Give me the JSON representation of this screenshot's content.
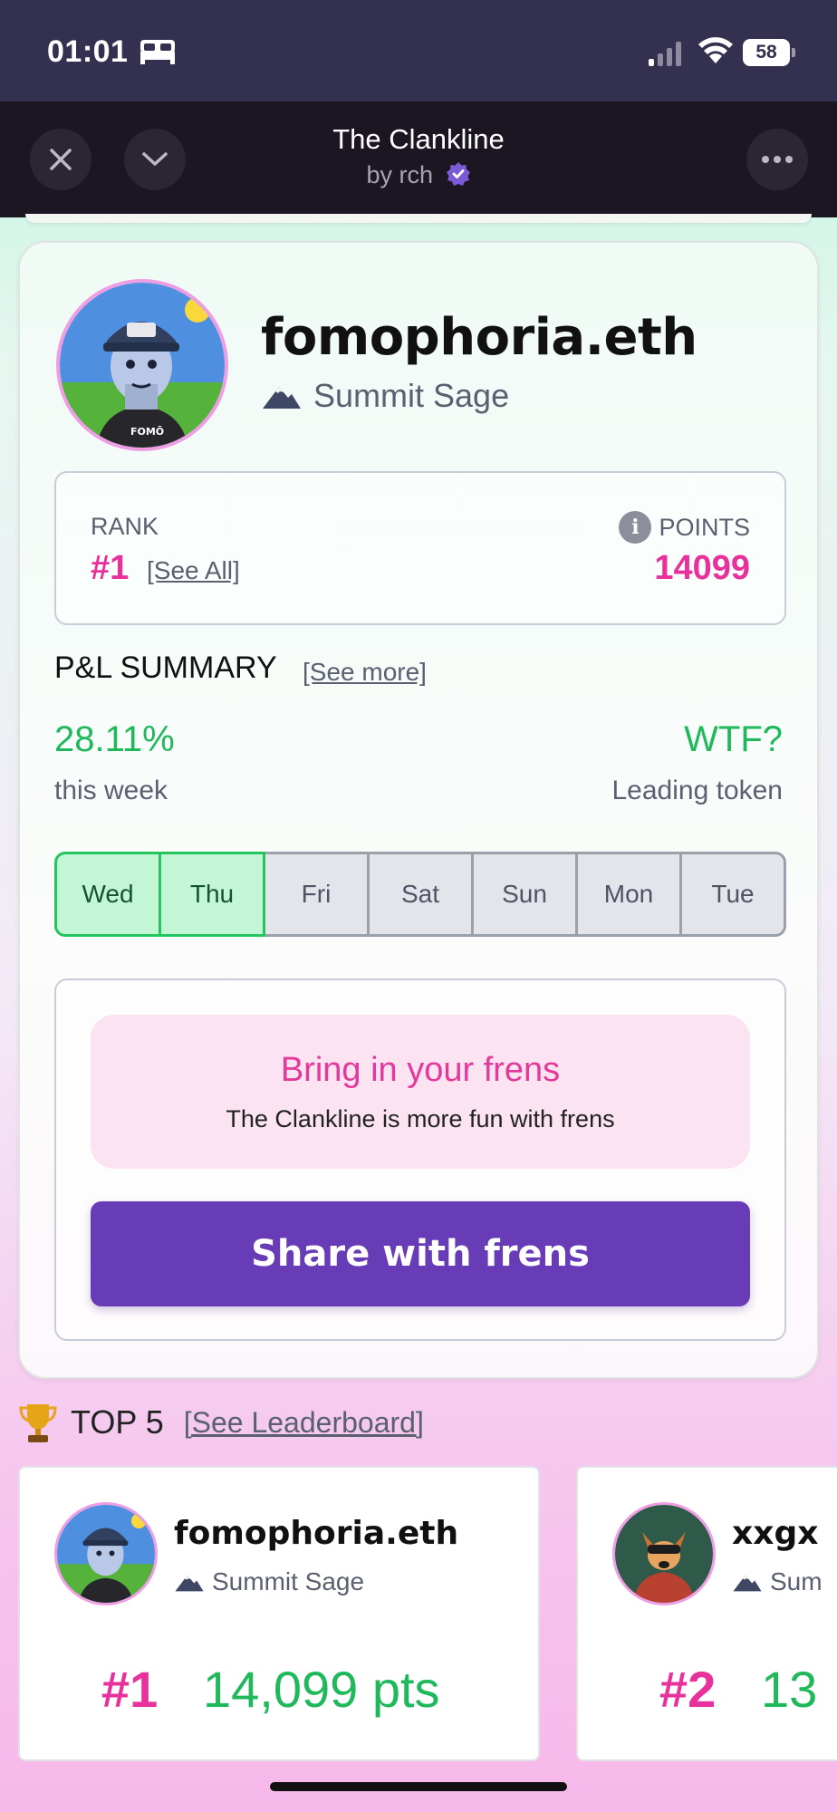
{
  "status_bar": {
    "time": "01:01",
    "battery": "58",
    "icons": [
      "bed-icon",
      "signal-icon",
      "wifi-icon",
      "battery-icon"
    ]
  },
  "app_header": {
    "title": "The Clankline",
    "subtitle": "by rch",
    "buttons": [
      "close-icon",
      "chevron-down-icon",
      "more-icon"
    ]
  },
  "profile": {
    "name": "fomophoria.eth",
    "title": "Summit Sage",
    "title_icon": "mountain-icon",
    "rank_label": "RANK",
    "rank": "#1",
    "see_all": "[See All]",
    "points_label": "POINTS",
    "points": "14099"
  },
  "pl_summary": {
    "heading": "P&L SUMMARY",
    "see_more": "[See more]",
    "percent": "28.11%",
    "period": "this week",
    "leading_token": "WTF?",
    "leading_token_label": "Leading token",
    "days": [
      {
        "label": "Wed",
        "active": true
      },
      {
        "label": "Thu",
        "active": true
      },
      {
        "label": "Fri",
        "active": false
      },
      {
        "label": "Sat",
        "active": false
      },
      {
        "label": "Sun",
        "active": false
      },
      {
        "label": "Mon",
        "active": false
      },
      {
        "label": "Tue",
        "active": false
      }
    ]
  },
  "invite": {
    "title": "Bring in your frens",
    "subtitle": "The Clankline is more fun with frens",
    "share_button": "Share with frens"
  },
  "top5": {
    "heading": "TOP 5",
    "see_leaderboard": "[See Leaderboard]",
    "entries": [
      {
        "name": "fomophoria.eth",
        "title": "Summit Sage",
        "rank": "#1",
        "points": "14,099 pts"
      },
      {
        "name": "xxgx",
        "title": "Sum",
        "rank": "#2",
        "points": "13"
      }
    ]
  },
  "colors": {
    "status_bar": "#34304f",
    "header": "#1b1622",
    "accent_pink": "#e8319b",
    "accent_green": "#1fb85a",
    "share_button": "#683bb7"
  }
}
